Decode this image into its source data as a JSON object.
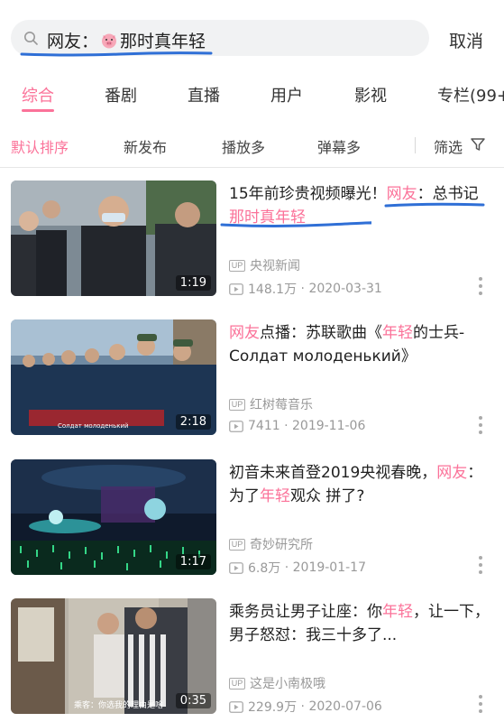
{
  "search": {
    "prefix": "网友：",
    "query": "那时真年轻",
    "cancel_label": "取消"
  },
  "tabs": [
    {
      "label": "综合"
    },
    {
      "label": "番剧"
    },
    {
      "label": "直播"
    },
    {
      "label": "用户"
    },
    {
      "label": "影视"
    },
    {
      "label": "专栏(99+"
    }
  ],
  "filters": [
    {
      "label": "默认排序"
    },
    {
      "label": "新发布"
    },
    {
      "label": "播放多"
    },
    {
      "label": "弹幕多"
    },
    {
      "label": "筛选"
    }
  ],
  "videos": [
    {
      "title_parts": [
        "15年前珍贵视频曝光！",
        "网友",
        "：总书记",
        "那时真年轻"
      ],
      "duration": "1:19",
      "uploader": "央视新闻",
      "views": "148.1万",
      "date": "2020-03-31"
    },
    {
      "title_parts": [
        "",
        "网友",
        "点播：苏联歌曲《",
        "年轻",
        "的士兵-Солдат молоденький》"
      ],
      "duration": "2:18",
      "uploader": "红树莓音乐",
      "views": "7411",
      "date": "2019-11-06",
      "thumb_caption": "Солдат молоденький"
    },
    {
      "title_parts": [
        "初音未来首登2019央视春晚，",
        "网友",
        "：为了",
        "年轻",
        "观众 拼了?"
      ],
      "duration": "1:17",
      "uploader": "奇妙研究所",
      "views": "6.8万",
      "date": "2019-01-17"
    },
    {
      "title_parts": [
        "乘务员让男子让座：你",
        "年轻",
        "，让一下，男子怒怼：我三十多了..."
      ],
      "duration": "0:35",
      "uploader": "这是小南极哦",
      "views": "229.9万",
      "date": "2020-07-06",
      "thumb_caption": "乘客：你选我的理由是啥"
    }
  ],
  "colors": {
    "accent": "#fb7299",
    "annotation": "#2f6fd6",
    "meta": "#999999"
  },
  "icons": {
    "search": "search-icon",
    "pig": "pig-emoji-icon",
    "filter": "filter-funnel-icon",
    "up": "up-badge-icon",
    "play": "play-count-icon",
    "more": "more-dots-icon"
  }
}
